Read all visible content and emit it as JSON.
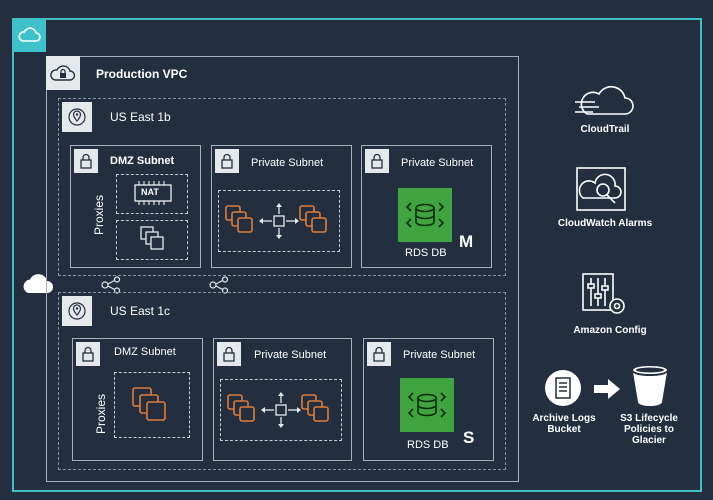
{
  "vpc": {
    "title": "Production VPC"
  },
  "zones": [
    {
      "name": "US East 1b",
      "subnets": [
        {
          "label": "DMZ Subnet",
          "side_label": "Proxies",
          "nat_label": "NAT"
        },
        {
          "label": "Private Subnet"
        },
        {
          "label": "Private Subnet",
          "db_label": "RDS DB",
          "db_role": "M"
        }
      ]
    },
    {
      "name": "US East 1c",
      "subnets": [
        {
          "label": "DMZ Subnet",
          "side_label": "Proxies"
        },
        {
          "label": "Private Subnet"
        },
        {
          "label": "Private Subnet",
          "db_label": "RDS DB",
          "db_role": "S"
        }
      ]
    }
  ],
  "services": {
    "cloudtrail": "CloudTrail",
    "cloudwatch": "CloudWatch Alarms",
    "config": "Amazon Config",
    "archive": "Archive Logs Bucket",
    "s3": "S3 Lifecycle Policies to Glacier"
  },
  "colors": {
    "background": "#232f3e",
    "cloud_border": "#3fc1c9",
    "rds_green": "#3fa33f",
    "instance_orange": "#e07b39"
  }
}
